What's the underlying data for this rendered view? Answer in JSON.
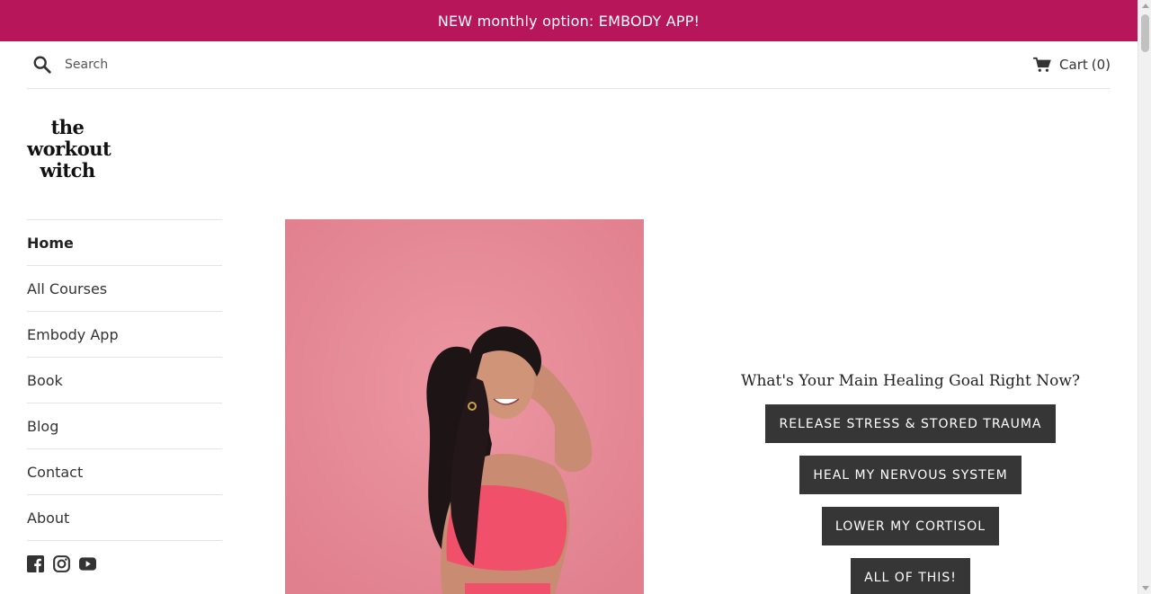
{
  "announcement": {
    "text": "NEW monthly option: EMBODY APP!"
  },
  "search": {
    "placeholder": "Search"
  },
  "cart": {
    "label": "Cart",
    "count_text": "(0)"
  },
  "logo": {
    "line1": "the",
    "line2": "workout",
    "line3": "witch"
  },
  "sidebar": {
    "items": [
      {
        "label": "Home",
        "active": true
      },
      {
        "label": "All Courses"
      },
      {
        "label": "Embody App"
      },
      {
        "label": "Book"
      },
      {
        "label": "Blog"
      },
      {
        "label": "Contact"
      },
      {
        "label": "About"
      }
    ]
  },
  "social": {
    "icons": [
      "facebook-icon",
      "instagram-icon",
      "youtube-icon"
    ]
  },
  "quiz": {
    "title": "What's Your Main Healing Goal Right Now?",
    "options": [
      "RELEASE STRESS & STORED TRAUMA",
      "HEAL MY NERVOUS SYSTEM",
      "LOWER MY CORTISOL",
      "ALL OF THIS!"
    ]
  },
  "colors": {
    "announcement_bg": "#b8165a",
    "button_bg": "#363636",
    "photo_bg": "#e58a98",
    "top_color": "#f0506a"
  }
}
